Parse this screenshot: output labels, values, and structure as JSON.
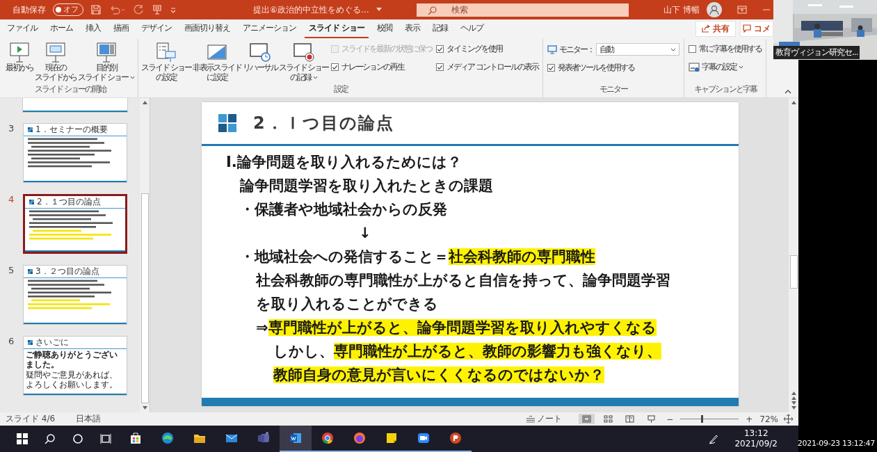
{
  "title_bar": {
    "autosave_label": "自動保存",
    "autosave_toggle": {
      "label": "オフ",
      "on": false
    },
    "document_title": "提出⑥政治的中立性をめぐる…",
    "search": {
      "placeholder": "検索"
    },
    "user_name": "山下 博暢"
  },
  "tabs": [
    {
      "label": "ファイル",
      "selected": false
    },
    {
      "label": "ホーム",
      "selected": false
    },
    {
      "label": "挿入",
      "selected": false
    },
    {
      "label": "描画",
      "selected": false
    },
    {
      "label": "デザイン",
      "selected": false
    },
    {
      "label": "画面切り替え",
      "selected": false
    },
    {
      "label": "アニメーション",
      "selected": false
    },
    {
      "label": "スライド ショー",
      "selected": true
    },
    {
      "label": "校閲",
      "selected": false
    },
    {
      "label": "表示",
      "selected": false
    },
    {
      "label": "記録",
      "selected": false
    },
    {
      "label": "ヘルプ",
      "selected": false
    }
  ],
  "share_button": "共有",
  "comment_button": "コメ",
  "ribbon_groups": [
    {
      "title": "スライド ショーの開始",
      "columns": [
        {
          "items": [
            {
              "kind": "large",
              "lines": [
                "最初から"
              ],
              "menu": false
            }
          ]
        },
        {
          "items": [
            {
              "kind": "large",
              "lines": [
                "現在の",
                "スライドから"
              ],
              "menu": false
            }
          ]
        },
        {
          "items": [
            {
              "kind": "large",
              "lines": [
                "目的別",
                "スライド ショー"
              ],
              "menu": true
            }
          ]
        }
      ]
    },
    {
      "title": "設定",
      "columns": [
        {
          "items": [
            {
              "kind": "large",
              "lines": [
                "スライド ショー",
                "の設定"
              ],
              "menu": false
            }
          ]
        },
        {
          "items": [
            {
              "kind": "large",
              "lines": [
                "非表示スライド",
                "に設定"
              ],
              "menu": false
            }
          ]
        },
        {
          "items": [
            {
              "kind": "large",
              "lines": [
                "リハーサル"
              ],
              "menu": false
            }
          ]
        },
        {
          "items": [
            {
              "kind": "large",
              "lines": [
                "スライド ショー",
                "の記録"
              ],
              "menu": true
            }
          ]
        },
        {
          "items": [
            {
              "kind": "checkbox",
              "label": "スライドを最新の状態に保つ",
              "checked": false,
              "disabled": true
            },
            {
              "kind": "checkbox",
              "label": "ナレーションの再生",
              "checked": true,
              "disabled": false
            }
          ]
        },
        {
          "items": [
            {
              "kind": "checkbox",
              "label": "タイミングを使用",
              "checked": true,
              "disabled": false
            },
            {
              "kind": "checkbox",
              "label": "メディア コントロールの表示",
              "checked": true,
              "disabled": false
            }
          ]
        }
      ]
    },
    {
      "title": "モニター",
      "columns": [
        {
          "items": [
            {
              "kind": "dropdown",
              "label": "モニター：",
              "value": "自動"
            },
            {
              "kind": "checkbox",
              "label": "発表者ツールを使用する",
              "checked": true,
              "disabled": false
            }
          ]
        }
      ]
    },
    {
      "title": "キャプションと字幕",
      "columns": [
        {
          "items": [
            {
              "kind": "checkbox",
              "label": "常に字幕を使用する",
              "checked": false,
              "disabled": false
            },
            {
              "kind": "small",
              "label": "字幕の設定",
              "menu": true
            }
          ]
        }
      ]
    }
  ],
  "thumbnails": [
    {
      "number": "3",
      "title": "1．セミナーの概要",
      "selected": false,
      "kind": "lines",
      "highlighted": false
    },
    {
      "number": "4",
      "title": "2．１つ目の論点",
      "selected": true,
      "kind": "lines",
      "highlighted": true
    },
    {
      "number": "5",
      "title": "3．２つ目の論点",
      "selected": false,
      "kind": "lines",
      "highlighted": true
    },
    {
      "number": "6",
      "title": "さいごに",
      "selected": false,
      "kind": "text",
      "body": [
        "ご静聴ありがとうございました。",
        "疑問やご意見があれば、よろしくお願いします。"
      ]
    }
  ],
  "slide": {
    "title": "2．Ｉつ目の論点",
    "lines": [
      {
        "kind": "heading",
        "segments": [
          {
            "text": "Ⅰ.論争問題を取り入れるためには？",
            "highlight": false
          }
        ]
      },
      {
        "kind": "sub",
        "segments": [
          {
            "text": "論争問題学習を取り入れたときの課題",
            "highlight": false
          }
        ]
      },
      {
        "kind": "sub",
        "segments": [
          {
            "text": "・保護者や地域社会からの反発",
            "highlight": false
          }
        ]
      },
      {
        "kind": "arrow",
        "segments": [
          {
            "text": "↓",
            "highlight": false
          }
        ]
      },
      {
        "kind": "sub",
        "segments": [
          {
            "text": "・地域社会への発信すること＝",
            "highlight": false
          },
          {
            "text": "社会科教師の専門職性",
            "highlight": true
          }
        ]
      },
      {
        "kind": "cont",
        "segments": [
          {
            "text": "社会科教師の専門職性が上がると自信を持って、論争問題学習",
            "highlight": false
          }
        ]
      },
      {
        "kind": "cont",
        "segments": [
          {
            "text": "を取り入れることができる",
            "highlight": false
          }
        ]
      },
      {
        "kind": "cont",
        "segments": [
          {
            "text": "⇒",
            "highlight": false
          },
          {
            "text": "専門職性が上がると、論争問題学習を取り入れやすくなる",
            "highlight": true
          }
        ]
      },
      {
        "kind": "deep",
        "segments": [
          {
            "text": "しかし、",
            "highlight": false
          },
          {
            "text": "専門職性が上がると、教師の影響力も強くなり、",
            "highlight": true
          }
        ]
      },
      {
        "kind": "deep",
        "segments": [
          {
            "text": "教師自身の意見が言いにくくなるのではないか？",
            "highlight": true
          }
        ]
      }
    ]
  },
  "status_bar": {
    "slide_indicator": "スライド 4/6",
    "language": "日本語",
    "notes_button": "ノート",
    "views": [
      {
        "selected": true
      },
      {
        "selected": false
      },
      {
        "selected": false
      },
      {
        "selected": false
      }
    ],
    "zoom_out": "−",
    "zoom_in": "+",
    "zoom": {
      "level": 0.37
    },
    "zoom_reading": "72%"
  },
  "taskbar": {
    "apps": [
      {
        "running": false,
        "active": false
      },
      {
        "running": false,
        "active": false
      },
      {
        "running": false,
        "active": false
      },
      {
        "running": false,
        "active": false
      },
      {
        "running": false,
        "active": false
      },
      {
        "running": true,
        "active": true
      },
      {
        "running": true,
        "active": false
      },
      {
        "running": true,
        "active": false
      },
      {
        "running": true,
        "active": false
      },
      {
        "running": true,
        "active": false
      },
      {
        "running": true,
        "active": false
      }
    ],
    "time": "13:12",
    "date": "2021/09/2"
  },
  "camera": {
    "label": "教育ヴィジョン研究セ..."
  },
  "timestamp": "2021-09-23 13:12:47"
}
